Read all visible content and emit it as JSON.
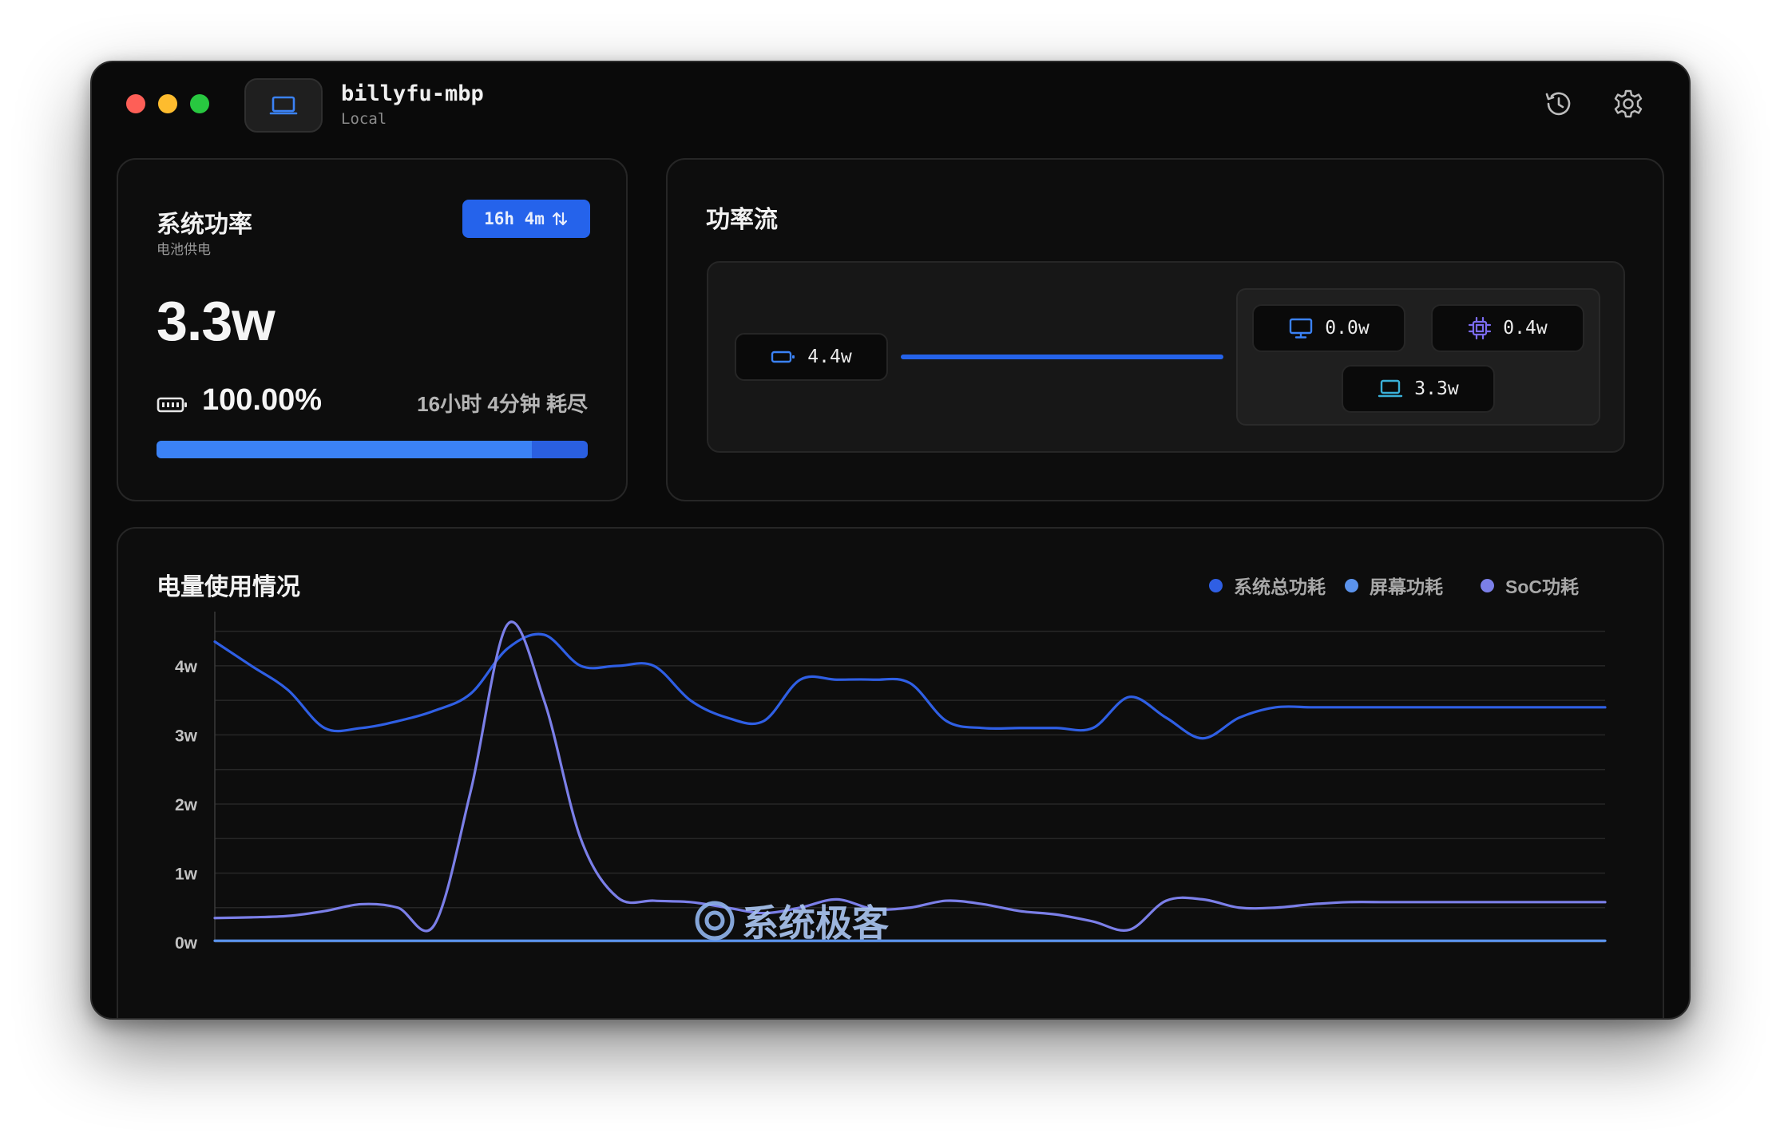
{
  "titlebar": {
    "host_name": "billyfu-mbp",
    "host_sub": "Local",
    "history_icon": "history-icon",
    "settings_icon": "gear-icon"
  },
  "system_power": {
    "title": "系统功率",
    "subtitle": "电池供电",
    "time_pill": "16h 4m",
    "time_pill_icon": "sort-arrows-icon",
    "power": "3.3w",
    "battery_icon": "battery-icon",
    "battery_percent": "100.00%",
    "remaining": "16小时 4分钟 耗尽",
    "battery_level": 0.87
  },
  "power_flow": {
    "title": "功率流",
    "source": {
      "icon": "battery-icon",
      "value": "4.4w"
    },
    "consumers": [
      {
        "name": "display",
        "icon": "monitor-icon",
        "value": "0.0w"
      },
      {
        "name": "soc",
        "icon": "cpu-icon",
        "value": "0.4w"
      },
      {
        "name": "system",
        "icon": "laptop-icon",
        "value": "3.3w"
      }
    ]
  },
  "usage": {
    "title": "电量使用情况",
    "legend": [
      {
        "label": "系统总功耗",
        "color": "#2f5fe4"
      },
      {
        "label": "屏幕功耗",
        "color": "#5b93ec"
      },
      {
        "label": "SoC功耗",
        "color": "#7b7fe8"
      }
    ]
  },
  "chart_data": {
    "type": "line",
    "title": "电量使用情况",
    "ylabel": "",
    "xlabel": "",
    "ylim": [
      0,
      4.6
    ],
    "yticks": [
      "0w",
      "1w",
      "2w",
      "3w",
      "4w"
    ],
    "ytick_values": [
      0,
      1,
      2,
      3,
      4
    ],
    "x": [
      0,
      0.5,
      1,
      1.5,
      2,
      2.5,
      3,
      3.5,
      4,
      4.5,
      5,
      5.5,
      6,
      6.5,
      7,
      7.5,
      8,
      8.5,
      9,
      9.5,
      10,
      10.5,
      11,
      11.5,
      12,
      12.5,
      13,
      13.5,
      14,
      14.5,
      15,
      15.5,
      16,
      16.5,
      17,
      17.5,
      18,
      18.5,
      19
    ],
    "series": [
      {
        "name": "系统总功耗",
        "color": "#2f5fe4",
        "values": [
          4.35,
          4.0,
          3.65,
          3.1,
          3.1,
          3.2,
          3.35,
          3.6,
          4.25,
          4.45,
          4.0,
          4.0,
          4.0,
          3.5,
          3.25,
          3.2,
          3.8,
          3.8,
          3.8,
          3.75,
          3.2,
          3.1,
          3.1,
          3.1,
          3.1,
          3.55,
          3.25,
          2.95,
          3.25,
          3.4,
          3.4,
          3.4,
          3.4,
          3.4,
          3.4,
          3.4,
          3.4,
          3.4,
          3.4
        ]
      },
      {
        "name": "屏幕功耗",
        "color": "#5b93ec",
        "values": [
          0.02,
          0.02,
          0.02,
          0.02,
          0.02,
          0.02,
          0.02,
          0.02,
          0.02,
          0.02,
          0.02,
          0.02,
          0.02,
          0.02,
          0.02,
          0.02,
          0.02,
          0.02,
          0.02,
          0.02,
          0.02,
          0.02,
          0.02,
          0.02,
          0.02,
          0.02,
          0.02,
          0.02,
          0.02,
          0.02,
          0.02,
          0.02,
          0.02,
          0.02,
          0.02,
          0.02,
          0.02,
          0.02,
          0.02
        ]
      },
      {
        "name": "SoC功耗",
        "color": "#7b7fe8",
        "values": [
          0.35,
          0.36,
          0.38,
          0.45,
          0.55,
          0.5,
          0.25,
          2.2,
          4.6,
          3.5,
          1.5,
          0.65,
          0.6,
          0.58,
          0.5,
          0.42,
          0.5,
          0.62,
          0.48,
          0.5,
          0.6,
          0.55,
          0.45,
          0.4,
          0.3,
          0.18,
          0.6,
          0.62,
          0.5,
          0.5,
          0.55,
          0.58,
          0.58,
          0.58,
          0.58,
          0.58,
          0.58,
          0.58,
          0.58
        ]
      }
    ],
    "grid": true,
    "legend_position": "top-right"
  },
  "watermark": {
    "text": "系统极客",
    "icon": "watermark-logo-icon"
  }
}
